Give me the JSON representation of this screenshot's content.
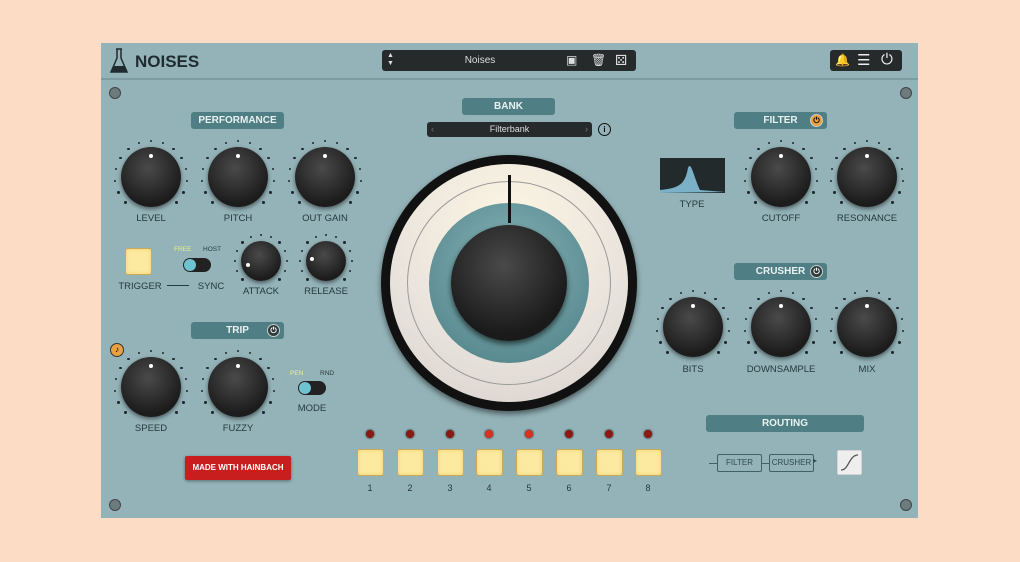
{
  "header": {
    "title": "NOISES",
    "preset_name": "Noises",
    "icons": [
      "flask-logo-icon",
      "preset-arrows-icon",
      "save-icon",
      "trash-icon",
      "dice-icon",
      "bell-icon",
      "menu-icon",
      "power-icon"
    ]
  },
  "performance": {
    "title": "PERFORMANCE",
    "trigger_label": "TRIGGER",
    "sync_label": "SYNC",
    "sync_options": [
      "FREE",
      "HOST"
    ],
    "sync_value": "FREE"
  },
  "trip": {
    "title": "TRIP",
    "mode_label": "MODE",
    "mode_options": [
      "PEN",
      "RND"
    ],
    "mode_value": "PEN"
  },
  "bank": {
    "title": "BANK",
    "selected": "Filterbank"
  },
  "filter": {
    "title": "FILTER",
    "type_label": "TYPE"
  },
  "crusher": {
    "title": "CRUSHER"
  },
  "routing": {
    "title": "ROUTING",
    "chain": [
      "FILTER",
      "CRUSHER"
    ]
  },
  "made_with": "MADE WITH HAINBACH",
  "knobs": [
    {
      "id": "level",
      "label": "LEVEL",
      "value": 0.5
    },
    {
      "id": "pitch",
      "label": "PITCH",
      "value": 0.5
    },
    {
      "id": "out-gain",
      "label": "OUT GAIN",
      "value": 0.5
    },
    {
      "id": "attack",
      "label": "ATTACK",
      "value": 0.1
    },
    {
      "id": "release",
      "label": "RELEASE",
      "value": 0.2
    },
    {
      "id": "speed",
      "label": "SPEED",
      "value": 0.5
    },
    {
      "id": "fuzzy",
      "label": "FUZZY",
      "value": 0.5
    },
    {
      "id": "cutoff",
      "label": "CUTOFF",
      "value": 0.5
    },
    {
      "id": "resonance",
      "label": "RESONANCE",
      "value": 0.5
    },
    {
      "id": "bits",
      "label": "BITS",
      "value": 0.5
    },
    {
      "id": "downsample",
      "label": "DOWNSAMPLE",
      "value": 0.5
    },
    {
      "id": "mix",
      "label": "MIX",
      "value": 0.5
    }
  ],
  "steps": [
    "1",
    "2",
    "3",
    "4",
    "5",
    "6",
    "7",
    "8"
  ],
  "step_leds_on": [
    false,
    false,
    false,
    true,
    true,
    false,
    false,
    false
  ],
  "colors": {
    "panel": "#94b3b8",
    "header": "#4f7e84",
    "pad": "#fbeaa0",
    "led": "#8a1a12",
    "made_with": "#c81e1e"
  }
}
